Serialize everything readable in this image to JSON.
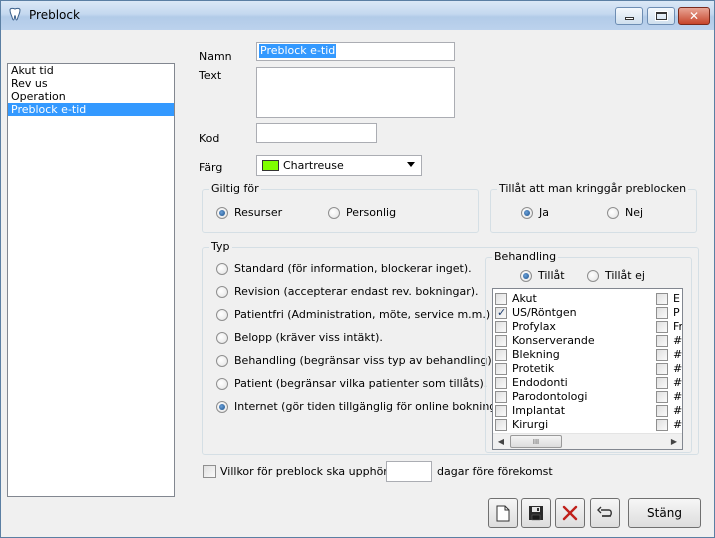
{
  "window": {
    "title": "Preblock"
  },
  "list": {
    "items": [
      "Akut tid",
      "Rev us",
      "Operation",
      "Preblock e-tid"
    ],
    "selected_index": 3
  },
  "form": {
    "namn_label": "Namn",
    "namn_value": "Preblock e-tid",
    "text_label": "Text",
    "text_value": "",
    "kod_label": "Kod",
    "kod_value": "",
    "farg_label": "Färg",
    "farg_value": "Chartreuse",
    "farg_color": "#7fff00"
  },
  "giltig": {
    "title": "Giltig för",
    "options": [
      "Resurser",
      "Personlig"
    ],
    "selected": "Resurser"
  },
  "tillat": {
    "title": "Tillåt att man kringgår preblocken",
    "options": [
      "Ja",
      "Nej"
    ],
    "selected": "Ja"
  },
  "typ": {
    "title": "Typ",
    "options": [
      "Standard (för information, blockerar inget).",
      "Revision (accepterar endast rev. bokningar).",
      "Patientfri (Administration, möte, service m.m.)",
      "Belopp (kräver viss intäkt).",
      "Behandling (begränsar viss typ av behandling).",
      "Patient (begränsar vilka patienter som tillåts).",
      "Internet (gör tiden tillgänglig för online bokning)."
    ],
    "selected_index": 6
  },
  "behandling": {
    "title": "Behandling",
    "mode_options": [
      "Tillåt",
      "Tillåt ej"
    ],
    "mode_selected": "Tillåt",
    "items": [
      {
        "label": "Akut",
        "checked": false
      },
      {
        "label": "US/Röntgen",
        "checked": true
      },
      {
        "label": "Profylax",
        "checked": false
      },
      {
        "label": "Konserverande",
        "checked": false
      },
      {
        "label": "Blekning",
        "checked": false
      },
      {
        "label": "Protetik",
        "checked": false
      },
      {
        "label": "Endodonti",
        "checked": false
      },
      {
        "label": "Parodontologi",
        "checked": false
      },
      {
        "label": "Implantat",
        "checked": false
      },
      {
        "label": "Kirurgi",
        "checked": false
      }
    ],
    "column2_items": [
      "E",
      "P",
      "Fr",
      "#",
      "#",
      "#",
      "#",
      "#",
      "#",
      "#"
    ],
    "scroll_thumb": "III"
  },
  "villkor": {
    "label": "Villkor för preblock ska upphöra",
    "days_value": "",
    "suffix": "dagar före förekomst"
  },
  "buttons": {
    "close_label": "Stäng"
  },
  "icons": [
    "tooth-icon",
    "minimize-icon",
    "maximize-icon",
    "close-icon",
    "new-document-icon",
    "save-icon",
    "delete-icon",
    "undo-icon"
  ]
}
